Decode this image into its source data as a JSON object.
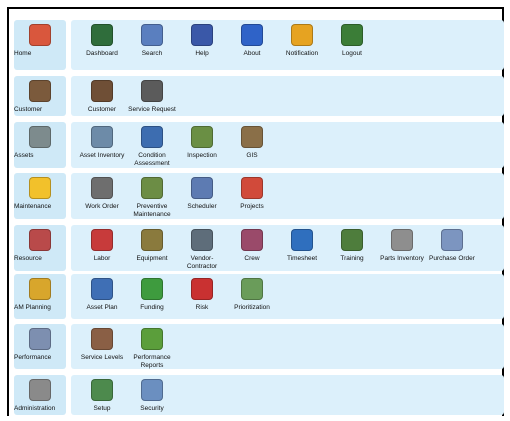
{
  "rows": [
    {
      "category": {
        "label": "Home",
        "icon": "home-icon",
        "color": "#d9573d"
      },
      "items": [
        {
          "label": "Dashboard",
          "icon": "dashboard-icon",
          "color": "#2f6d3b"
        },
        {
          "label": "Search",
          "icon": "search-icon",
          "color": "#5a7fbf"
        },
        {
          "label": "Help",
          "icon": "help-icon",
          "color": "#3a58a8"
        },
        {
          "label": "About",
          "icon": "info-icon",
          "color": "#2f63c8"
        },
        {
          "label": "Notification",
          "icon": "bell-icon",
          "color": "#e6a321"
        },
        {
          "label": "Logout",
          "icon": "door-icon",
          "color": "#3b7d37"
        }
      ]
    },
    {
      "category": {
        "label": "Customer",
        "icon": "customer-icon",
        "color": "#7b5a3c"
      },
      "items": [
        {
          "label": "Customer",
          "icon": "customer-icon",
          "color": "#6f4f36"
        },
        {
          "label": "Service Request",
          "icon": "service-request-icon",
          "color": "#5b5b5b"
        }
      ]
    },
    {
      "category": {
        "label": "Assets",
        "icon": "building-icon",
        "color": "#7d8b8d"
      },
      "items": [
        {
          "label": "Asset Inventory",
          "icon": "asset-inventory-icon",
          "color": "#6d8ba8"
        },
        {
          "label": "Condition Assessment",
          "icon": "condition-assessment-icon",
          "color": "#3d6db0"
        },
        {
          "label": "Inspection",
          "icon": "inspection-icon",
          "color": "#6a8f44"
        },
        {
          "label": "GIS",
          "icon": "gis-icon",
          "color": "#8a6f48"
        }
      ]
    },
    {
      "category": {
        "label": "Maintenance",
        "icon": "hardhat-icon",
        "color": "#f2c12b"
      },
      "items": [
        {
          "label": "Work Order",
          "icon": "tools-icon",
          "color": "#6e6e6e"
        },
        {
          "label": "Preventive Maintenance",
          "icon": "preventive-maintenance-icon",
          "color": "#6c8d45"
        },
        {
          "label": "Scheduler",
          "icon": "scheduler-icon",
          "color": "#5d7bb2"
        },
        {
          "label": "Projects",
          "icon": "projects-icon",
          "color": "#d14a3a"
        }
      ]
    },
    {
      "category": {
        "label": "Resource",
        "icon": "resource-icon",
        "color": "#b94a4a"
      },
      "items": [
        {
          "label": "Labor",
          "icon": "labor-icon",
          "color": "#c73b3b"
        },
        {
          "label": "Equipment",
          "icon": "equipment-icon",
          "color": "#8a7a3d"
        },
        {
          "label": "Vendor-Contractor",
          "icon": "vendor-icon",
          "color": "#5e6d7a"
        },
        {
          "label": "Crew",
          "icon": "crew-icon",
          "color": "#9a4a6a"
        },
        {
          "label": "Timesheet",
          "icon": "clock-icon",
          "color": "#2f6fbe"
        },
        {
          "label": "Training",
          "icon": "training-icon",
          "color": "#4e7d3c"
        },
        {
          "label": "Parts Inventory",
          "icon": "parts-icon",
          "color": "#8e8e8e"
        },
        {
          "label": "Purchase Order",
          "icon": "purchase-order-icon",
          "color": "#7c95c0"
        }
      ]
    },
    {
      "category": {
        "label": "AM Planning",
        "icon": "planning-icon",
        "color": "#d8a62c"
      },
      "items": [
        {
          "label": "Asset Plan",
          "icon": "asset-plan-icon",
          "color": "#3f6fb5"
        },
        {
          "label": "Funding",
          "icon": "dollar-icon",
          "color": "#3e9b3e"
        },
        {
          "label": "Risk",
          "icon": "risk-icon",
          "color": "#c93131"
        },
        {
          "label": "Prioritization",
          "icon": "prioritization-icon",
          "color": "#6a9c5a"
        }
      ]
    },
    {
      "category": {
        "label": "Performance",
        "icon": "performance-icon",
        "color": "#7d8fb0"
      },
      "items": [
        {
          "label": "Service Levels",
          "icon": "handshake-icon",
          "color": "#8a5f45"
        },
        {
          "label": "Performance Reports",
          "icon": "reports-icon",
          "color": "#5b9e3b"
        }
      ]
    },
    {
      "category": {
        "label": "Administration",
        "icon": "admin-icon",
        "color": "#8a8a8a"
      },
      "items": [
        {
          "label": "Setup",
          "icon": "setup-icon",
          "color": "#4d8a4d"
        },
        {
          "label": "Security",
          "icon": "shield-icon",
          "color": "#6b8fc0"
        }
      ]
    }
  ]
}
